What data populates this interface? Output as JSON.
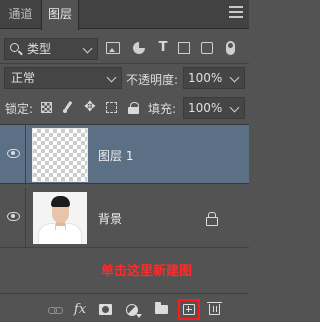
{
  "tabs": [
    {
      "label": "通道"
    },
    {
      "label": "图层"
    }
  ],
  "filter": {
    "kind_label": "类型",
    "icons": [
      "image-filter-icon",
      "adjustment-filter-icon",
      "type-filter-icon",
      "shape-filter-icon",
      "smartobject-filter-icon",
      "filter-toggle-icon"
    ]
  },
  "blend": {
    "mode": "正常",
    "opacity_label": "不透明度:",
    "opacity_value": "100%"
  },
  "lock": {
    "label": "锁定:",
    "icons": [
      "lock-transparent-pixels-icon",
      "lock-image-pixels-icon",
      "lock-position-icon",
      "lock-artboard-icon",
      "lock-all-icon"
    ],
    "fill_label": "填充:",
    "fill_value": "100%"
  },
  "layers": [
    {
      "name": "图层 1",
      "selected": true,
      "thumbnail": "transparent"
    },
    {
      "name": "背景",
      "selected": false,
      "thumbnail": "portrait-photo",
      "locked": true
    }
  ],
  "annotation": "单击这里新建图",
  "bottom_icons": [
    "link-layers-icon",
    "fx-icon",
    "layer-mask-icon",
    "adjustment-layer-icon",
    "group-folder-icon",
    "new-layer-icon",
    "trash-icon"
  ],
  "colors": {
    "panel_bg": "#535353",
    "selected_layer_bg": "#5c7085",
    "annotation_red": "#ff2a2a",
    "highlight_box": "#ff1a1a"
  }
}
